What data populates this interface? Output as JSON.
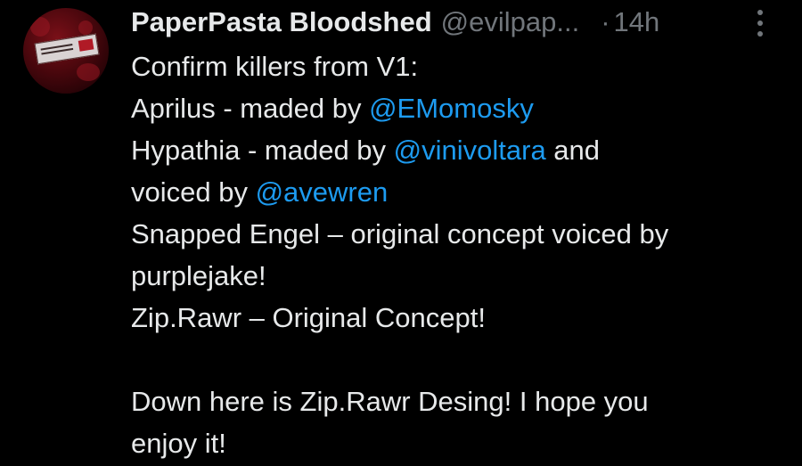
{
  "author": {
    "display_name": "PaperPasta Bloodshed",
    "handle": "@evilpap...",
    "separator": "·",
    "time": "14h"
  },
  "icons": {
    "more": "more-vertical-icon",
    "avatar": "profile-avatar"
  },
  "colors": {
    "background": "#000000",
    "text": "#e7e9ea",
    "muted": "#71767b",
    "link": "#1d9bf0"
  },
  "body": {
    "line1": "Confirm killers from V1:",
    "line2_text": "Aprilus - maded by ",
    "line2_mention": "@EMomosky",
    "line3_text": "Hypathia - maded by ",
    "line3_mention": "@vinivoltara",
    "line3_tail": " and",
    "line4_text": "voiced by ",
    "line4_mention": "@avewren",
    "line5": "Snapped Engel – original concept voiced by",
    "line6": "purplejake!",
    "line7": "Zip.Rawr – Original Concept!",
    "line8": "Down here is Zip.Rawr Desing! I hope you",
    "line9": "enjoy it!"
  }
}
